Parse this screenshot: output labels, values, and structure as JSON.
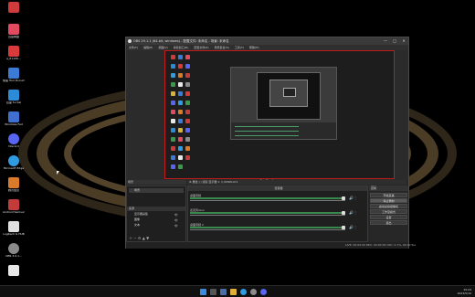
{
  "desktop_icons": [
    {
      "label": "",
      "color": "#cf3a3a"
    },
    {
      "label": "百度网盘",
      "color": "#e24b5f"
    },
    {
      "label": "a_6110K...",
      "color": "#d93a3a"
    },
    {
      "label": "快速 Tool Document",
      "color": "#3b7bd6"
    },
    {
      "label": "百度 Su Sal",
      "color": "#2c8bd8"
    },
    {
      "label": "Windows Fed",
      "color": "#3f6fd0"
    },
    {
      "label": "Discord",
      "color": "#5865f2"
    },
    {
      "label": "Microsoft Edge",
      "color": "#2f9be0"
    },
    {
      "label": "腾讯会议",
      "color": "#d97b2a"
    },
    {
      "label": "Android Samsung",
      "color": "#c33b3b"
    },
    {
      "label": "Logitech G HUB",
      "color": "#e0e0e0"
    },
    {
      "label": "OBS 3.0.1...",
      "color": "#8a8a8a"
    },
    {
      "label": "",
      "color": "#e8e8e8"
    }
  ],
  "obs": {
    "title": "OBS 29.1.1 (64-bit, windows) - 配置文件: 未命名 - 场景: 未命名",
    "menu": [
      "文件(F)",
      "编辑(E)",
      "视图(V)",
      "停靠窗口(D)",
      "配置文件(P)",
      "场景集合(S)",
      "工具(T)",
      "帮助(H)"
    ],
    "window_controls": [
      "—",
      "□",
      "✕"
    ],
    "preview_bar_text": "⏺  ⏹  ⏸",
    "panels": {
      "scenes_header": "场景",
      "scene_items": [
        "场景"
      ],
      "sources_header": "来源",
      "source_items": [
        "显示器采集",
        "图像",
        "文本"
      ],
      "mixer_header": "混音器",
      "mixer_tracks": [
        {
          "name": "桌面音频",
          "level": "0.0 dB"
        },
        {
          "name": "麦克风/Aux",
          "level": "0.0 dB"
        },
        {
          "name": "桌面音频 2",
          "level": "0.0 dB"
        }
      ],
      "transitions_header": "转场",
      "controls_header": "控制",
      "controls": [
        "开始直播",
        "停止录制",
        "启动虚拟摄像机",
        "工作室模式",
        "设置",
        "退出"
      ],
      "source_toolbar": "⚙ 属性  ◰ 滤镜  显示器 1: \\\\.\\DISPLAY1"
    },
    "status": "LIVE: 00:00:00   REC: 00:00:05   CPU: 2.1%, 60.00 fps"
  },
  "taskbar": {
    "time": "15:24",
    "date": "2023/5/10"
  }
}
